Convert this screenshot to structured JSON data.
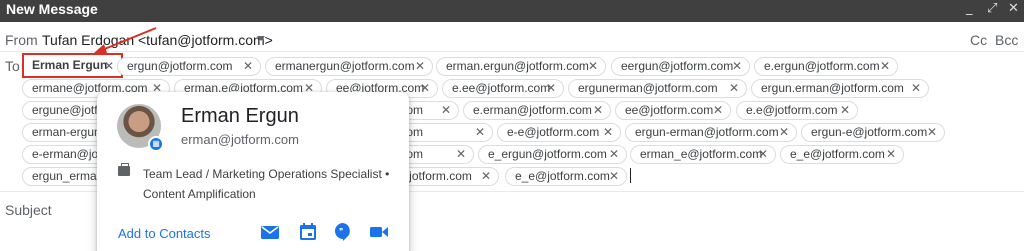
{
  "window": {
    "title": "New Message",
    "controls": [
      "_",
      "⤢",
      "✕"
    ]
  },
  "from": {
    "label": "From",
    "value": "Tufan Erdogan <tufan@jotform.com>"
  },
  "cc_bcc": {
    "cc": "Cc",
    "bcc": "Bcc"
  },
  "to": {
    "label": "To"
  },
  "subject": {
    "label": "Subject"
  },
  "colors": {
    "accent": "#1a73e8",
    "highlight_border": "#d93025",
    "titlebar": "#404040"
  },
  "recipients": [
    "Erman Ergun",
    "ergun@jotform.com",
    "ermanergun@jotform.com",
    "erman.ergun@jotform.com",
    "eergun@jotform.com",
    "e.ergun@jotform.com",
    "ermane@jotform.com",
    "erman.e@jotform.com",
    "ee@jotform.com",
    "e.ee@jotform.com",
    "ergunerman@jotform.com",
    "ergun.erman@jotform.com",
    "ergune@jotform.com",
    "e.erman@jotform.com",
    "ee@jotform.com",
    "e.e@jotform.com",
    "erman-ergun@jotform.com",
    "e-e@jotform.com",
    "ergun-erman@jotform.com",
    "ergun-e@jotform.com",
    "e-erman@jotform.com",
    "e_ergun@jotform.com",
    "erman_e@jotform.com",
    "e_e@jotform.com",
    "ergun_erman@jotform.com",
    "e_e@jotform.com"
  ],
  "contact_card": {
    "name": "Erman Ergun",
    "email": "erman@jotform.com",
    "job": "Team Lead / Marketing Operations Specialist • Content Amplification",
    "add_to_contacts": "Add to Contacts",
    "actions": [
      "mail-icon",
      "calendar-icon",
      "chat-icon",
      "video-icon"
    ]
  }
}
